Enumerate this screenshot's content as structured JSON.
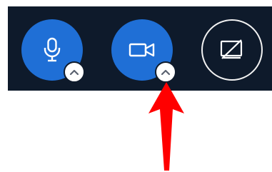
{
  "colors": {
    "toolbar_background": "#0e1a2b",
    "accent_blue": "#1f6fd6",
    "icon_white": "#ffffff",
    "chevron_gray": "#5a6270",
    "annotation_red": "#ff0000",
    "page_background": "#ffffff"
  },
  "toolbar": {
    "mute_button": {
      "icon": "microphone-icon",
      "options": {
        "icon": "chevron-up-icon"
      }
    },
    "video_button": {
      "icon": "video-camera-icon",
      "options": {
        "icon": "chevron-up-icon"
      }
    },
    "share_screen_button": {
      "icon": "screen-share-off-icon"
    }
  },
  "annotation": {
    "icon": "red-arrow-up-icon"
  }
}
